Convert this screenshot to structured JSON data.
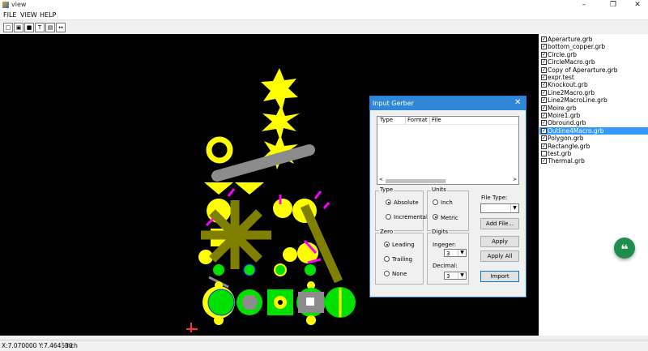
{
  "window": {
    "title": "view"
  },
  "menu": [
    "FILE",
    "VIEW",
    "HELP"
  ],
  "toolbar": {
    "icons": [
      "new-file-icon",
      "open-folder-icon",
      "save-icon",
      "text-icon",
      "layers-icon",
      "measure-icon"
    ]
  },
  "files": [
    {
      "name": "Aperarture.grb",
      "checked": true
    },
    {
      "name": "bottom_copper.grb",
      "checked": true
    },
    {
      "name": "Circle.grb",
      "checked": true
    },
    {
      "name": "CircleMacro.grb",
      "checked": true
    },
    {
      "name": "Copy of Aperarture.grb",
      "checked": true
    },
    {
      "name": "expr.test",
      "checked": true
    },
    {
      "name": "Knockout.grb",
      "checked": true
    },
    {
      "name": "Line2Macro.grb",
      "checked": true
    },
    {
      "name": "Line2MacroLine.grb",
      "checked": true
    },
    {
      "name": "Moire.grb",
      "checked": true
    },
    {
      "name": "Moire1.grb",
      "checked": true
    },
    {
      "name": "Obround.grb",
      "checked": true
    },
    {
      "name": "Outline4Macro.grb",
      "checked": true,
      "selected": true
    },
    {
      "name": "Polygon.grb",
      "checked": true
    },
    {
      "name": "Rectangle.grb",
      "checked": true
    },
    {
      "name": "test.grb",
      "checked": false
    },
    {
      "name": "Thermal.grb",
      "checked": true
    }
  ],
  "status": {
    "coords": "X:7.070000 Y:7.464530",
    "units": "Inch"
  },
  "dialog": {
    "title": "Input Gerber",
    "columns": [
      "Type",
      "Format",
      "File"
    ],
    "type_group": {
      "label": "Type",
      "options": [
        "Absolute",
        "Incremental"
      ],
      "selected": "Absolute"
    },
    "units_group": {
      "label": "Units",
      "options": [
        "Inch",
        "Metric"
      ],
      "selected": "Metric"
    },
    "zero_group": {
      "label": "Zero",
      "options": [
        "Leading",
        "Trailing",
        "None"
      ],
      "selected": "Leading"
    },
    "digits_group": {
      "label": "Digits",
      "integer_label": "Ingeger:",
      "integer_value": "3",
      "decimal_label": "Decimal:",
      "decimal_value": "3"
    },
    "file_type_label": "File Type:",
    "file_type_value": "",
    "buttons": {
      "add_file": "Add File...",
      "apply": "Apply",
      "apply_all": "Apply All",
      "import": "Import"
    }
  },
  "colors": {
    "accent": "#3399ff",
    "titlebar": "#2f87d8",
    "fab": "#1e8e4e",
    "yellow": "#ffff00",
    "olive": "#808000",
    "green": "#00e000",
    "magenta": "#ff00ff",
    "gray": "#8c8c8c"
  }
}
